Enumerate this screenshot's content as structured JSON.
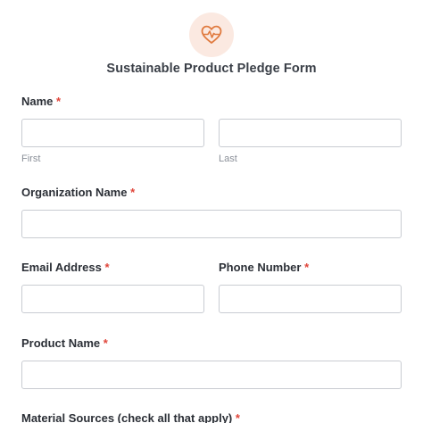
{
  "form": {
    "title": "Sustainable Product Pledge Form",
    "required_marker": "*",
    "accent_color": "#e07a3f",
    "logo_icon": "heart-pulse-icon"
  },
  "fields": {
    "name": {
      "label": "Name",
      "first_value": "",
      "last_value": "",
      "first_sublabel": "First",
      "last_sublabel": "Last"
    },
    "organization": {
      "label": "Organization Name",
      "value": ""
    },
    "email": {
      "label": "Email Address",
      "value": ""
    },
    "phone": {
      "label": "Phone Number",
      "value": ""
    },
    "product": {
      "label": "Product Name",
      "value": ""
    },
    "material_sources": {
      "label": "Material Sources (check all that apply)"
    }
  }
}
